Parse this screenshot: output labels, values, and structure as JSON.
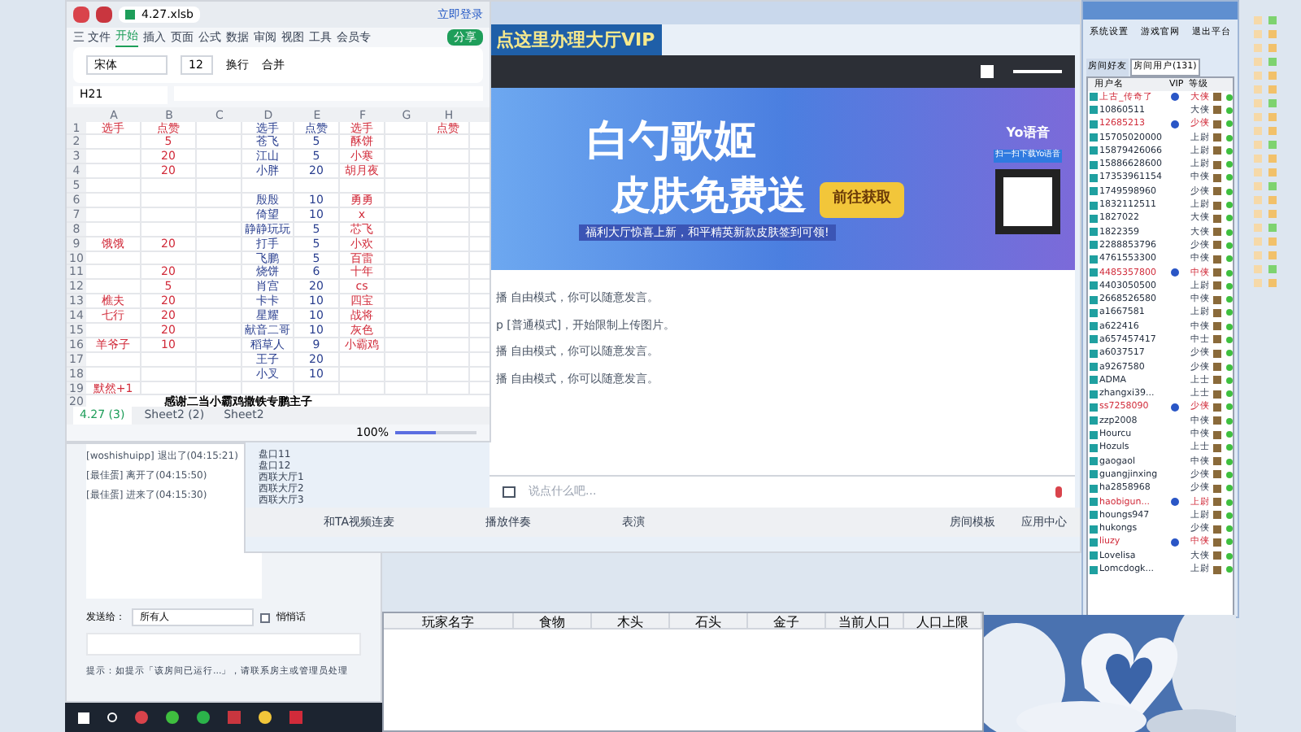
{
  "spreadsheet": {
    "file_tab": "4.27.xlsb",
    "login": "立即登录",
    "menu": [
      {
        "label": "三 文件",
        "selected": false
      },
      {
        "label": "开始",
        "selected": true
      },
      {
        "label": "插入",
        "selected": false
      },
      {
        "label": "页面",
        "selected": false
      },
      {
        "label": "公式",
        "selected": false
      },
      {
        "label": "数据",
        "selected": false
      },
      {
        "label": "审阅",
        "selected": false
      },
      {
        "label": "视图",
        "selected": false
      },
      {
        "label": "工具",
        "selected": false
      },
      {
        "label": "会员专",
        "selected": false
      }
    ],
    "share": "分享",
    "font": "宋体",
    "size": "12",
    "wrap": "换行",
    "merge": "合并",
    "name_box": "H21",
    "columns": [
      "A",
      "B",
      "C",
      "D",
      "E",
      "F",
      "G",
      "H"
    ],
    "rows": [
      [
        "选手",
        "点赞",
        "",
        "选手",
        "点赞",
        "选手",
        "",
        "点赞"
      ],
      [
        "",
        "5",
        "",
        "苍飞",
        "5",
        "酥饼",
        "",
        ""
      ],
      [
        "",
        "20",
        "",
        "江山",
        "5",
        "小寒",
        "",
        ""
      ],
      [
        "",
        "20",
        "",
        "小胖",
        "20",
        "胡月夜",
        "",
        ""
      ],
      [
        "",
        "",
        "",
        "",
        "",
        "",
        "",
        ""
      ],
      [
        "",
        "",
        "",
        "殷殷",
        "10",
        "勇勇",
        "",
        ""
      ],
      [
        "",
        "",
        "",
        "倚望",
        "10",
        "x",
        "",
        ""
      ],
      [
        "",
        "",
        "",
        "静静玩玩",
        "5",
        "芯飞",
        "",
        ""
      ],
      [
        "饿饿",
        "20",
        "",
        "打手",
        "5",
        "小欢",
        "",
        ""
      ],
      [
        "",
        "",
        "",
        "飞鹏",
        "5",
        "百雷",
        "",
        ""
      ],
      [
        "",
        "20",
        "",
        "烧饼",
        "6",
        "十年",
        "",
        ""
      ],
      [
        "",
        "5",
        "",
        "肖宫",
        "20",
        "cs",
        "",
        ""
      ],
      [
        "樵夫",
        "20",
        "",
        "卡卡",
        "10",
        "四宝",
        "",
        ""
      ],
      [
        "七行",
        "20",
        "",
        "星耀",
        "10",
        "战将",
        "",
        ""
      ],
      [
        "",
        "20",
        "",
        "献音二哥",
        "10",
        "灰色",
        "",
        ""
      ],
      [
        "羊爷子",
        "10",
        "",
        "稻草人",
        "9",
        "小霸鸡",
        "",
        ""
      ],
      [
        "",
        "",
        "",
        "王子",
        "20",
        "",
        "",
        ""
      ],
      [
        "",
        "",
        "",
        "小叉",
        "10",
        "",
        "",
        ""
      ],
      [
        "默然+1",
        "",
        "",
        "",
        "",
        "",
        "",
        ""
      ]
    ],
    "footer_row": "感谢二当小霸鸡撒铁专鹏主子",
    "sheets": [
      {
        "label": "4.27 (3)",
        "selected": true
      },
      {
        "label": "Sheet2 (2)",
        "selected": false
      },
      {
        "label": "Sheet2",
        "selected": false
      }
    ],
    "zoom": "100%",
    "zoom_slider": {
      "level": 0.5
    },
    "row_labels": [
      "1",
      "2",
      "3",
      "4",
      "5",
      "6",
      "7",
      "8",
      "9",
      "10",
      "11",
      "12",
      "13",
      "14",
      "15",
      "16",
      "17",
      "18",
      "19",
      "20"
    ]
  },
  "hall": {
    "vip_banner": "点这里办理大厅VIP",
    "ad": {
      "title": "白勺歌姬",
      "subtitle": "皮肤免费送",
      "cta": "前往获取",
      "caption": "福利大厅惊喜上新，和平精英新款皮肤签到可领!",
      "brand": "Yo语音",
      "qr_caption": "扫一扫下载Yo语音"
    },
    "messages": [
      "播 自由模式，你可以随意发言。",
      "p [普通模式]，开始限制上传图片。",
      "播 自由模式，你可以随意发言。",
      "播 自由模式，你可以随意发言。"
    ],
    "rooms": [
      "盘口11",
      "盘口12",
      "西联大厅1",
      "西联大厅2",
      "西联大厅3"
    ],
    "input": {
      "placeholder": "说点什么吧..."
    },
    "toolbar": [
      "和TA视频连麦",
      "播放伴奏",
      "表演"
    ],
    "toolbar_right": [
      "房间模板",
      "应用中心"
    ]
  },
  "users_panel": {
    "buttons": [
      "系统设置",
      "游戏官网",
      "退出平台"
    ],
    "tabs": [
      {
        "label": "房间好友",
        "selected": false
      },
      {
        "label": "房间用户(131)",
        "selected": true
      }
    ],
    "columns": [
      "用户名",
      "VIP",
      "等级"
    ],
    "users": [
      {
        "name": "上古_传奇了",
        "vip": true,
        "rank": "大侠",
        "highlighted": true
      },
      {
        "name": "10860511",
        "vip": false,
        "rank": "大侠",
        "highlighted": false
      },
      {
        "name": "12685213",
        "vip": true,
        "rank": "少侠",
        "highlighted": true
      },
      {
        "name": "15705020000",
        "vip": false,
        "rank": "上尉",
        "highlighted": false
      },
      {
        "name": "15879426066",
        "vip": false,
        "rank": "上尉",
        "highlighted": false
      },
      {
        "name": "15886628600",
        "vip": false,
        "rank": "上尉",
        "highlighted": false
      },
      {
        "name": "17353961154",
        "vip": false,
        "rank": "中侠",
        "highlighted": false
      },
      {
        "name": "1749598960",
        "vip": false,
        "rank": "少侠",
        "highlighted": false
      },
      {
        "name": "1832112511",
        "vip": false,
        "rank": "上尉",
        "highlighted": false
      },
      {
        "name": "1827022",
        "vip": false,
        "rank": "大侠",
        "highlighted": false
      },
      {
        "name": "1822359",
        "vip": false,
        "rank": "大侠",
        "highlighted": false
      },
      {
        "name": "2288853796",
        "vip": false,
        "rank": "少侠",
        "highlighted": false
      },
      {
        "name": "4761553300",
        "vip": false,
        "rank": "中侠",
        "highlighted": false
      },
      {
        "name": "4485357800",
        "vip": true,
        "rank": "中侠",
        "highlighted": true
      },
      {
        "name": "4403050500",
        "vip": false,
        "rank": "上尉",
        "highlighted": false
      },
      {
        "name": "2668526580",
        "vip": false,
        "rank": "中侠",
        "highlighted": false
      },
      {
        "name": "a1667581",
        "vip": false,
        "rank": "上尉",
        "highlighted": false
      },
      {
        "name": "a622416",
        "vip": false,
        "rank": "中侠",
        "highlighted": false
      },
      {
        "name": "a657457417",
        "vip": false,
        "rank": "中士",
        "highlighted": false
      },
      {
        "name": "a6037517",
        "vip": false,
        "rank": "少侠",
        "highlighted": false
      },
      {
        "name": "a9267580",
        "vip": false,
        "rank": "少侠",
        "highlighted": false
      },
      {
        "name": "ADMA",
        "vip": false,
        "rank": "上士",
        "highlighted": false
      },
      {
        "name": "zhangxi39...",
        "vip": false,
        "rank": "上士",
        "highlighted": false
      },
      {
        "name": "ss7258090",
        "vip": true,
        "rank": "少侠",
        "highlighted": true
      },
      {
        "name": "zzp2008",
        "vip": false,
        "rank": "中侠",
        "highlighted": false
      },
      {
        "name": "Hourcu",
        "vip": false,
        "rank": "中侠",
        "highlighted": false
      },
      {
        "name": "Hozuls",
        "vip": false,
        "rank": "上士",
        "highlighted": false
      },
      {
        "name": "gaogaol",
        "vip": false,
        "rank": "中侠",
        "highlighted": false
      },
      {
        "name": "guangjinxing",
        "vip": false,
        "rank": "少侠",
        "highlighted": false
      },
      {
        "name": "ha2858968",
        "vip": false,
        "rank": "少侠",
        "highlighted": false
      },
      {
        "name": "haobigun...",
        "vip": true,
        "rank": "上尉",
        "highlighted": true
      },
      {
        "name": "houngs947",
        "vip": false,
        "rank": "上尉",
        "highlighted": false
      },
      {
        "name": "hukongs",
        "vip": false,
        "rank": "少侠",
        "highlighted": false
      },
      {
        "name": "liuzy",
        "vip": true,
        "rank": "中侠",
        "highlighted": true
      },
      {
        "name": "Lovelisa",
        "vip": false,
        "rank": "大侠",
        "highlighted": false
      },
      {
        "name": "Lomcdogk...",
        "vip": false,
        "rank": "上尉",
        "highlighted": false
      }
    ]
  },
  "chat": {
    "messages": [
      "[woshishuipp] 退出了(04:15:21)",
      "[最佳蛋] 离开了(04:15:50)",
      "[最佳蛋] 进来了(04:15:30)"
    ],
    "send_to_label": "发送给：",
    "send_to": "所有人",
    "whisper": {
      "label": "悄悄话",
      "checked": false
    },
    "hint": "提示：如提示「该房间已运行...」，请联系房主或管理员处理"
  },
  "resources_table": {
    "columns": [
      "玩家名字",
      "食物",
      "木头",
      "石头",
      "金子",
      "当前人口",
      "人口上限"
    ]
  }
}
